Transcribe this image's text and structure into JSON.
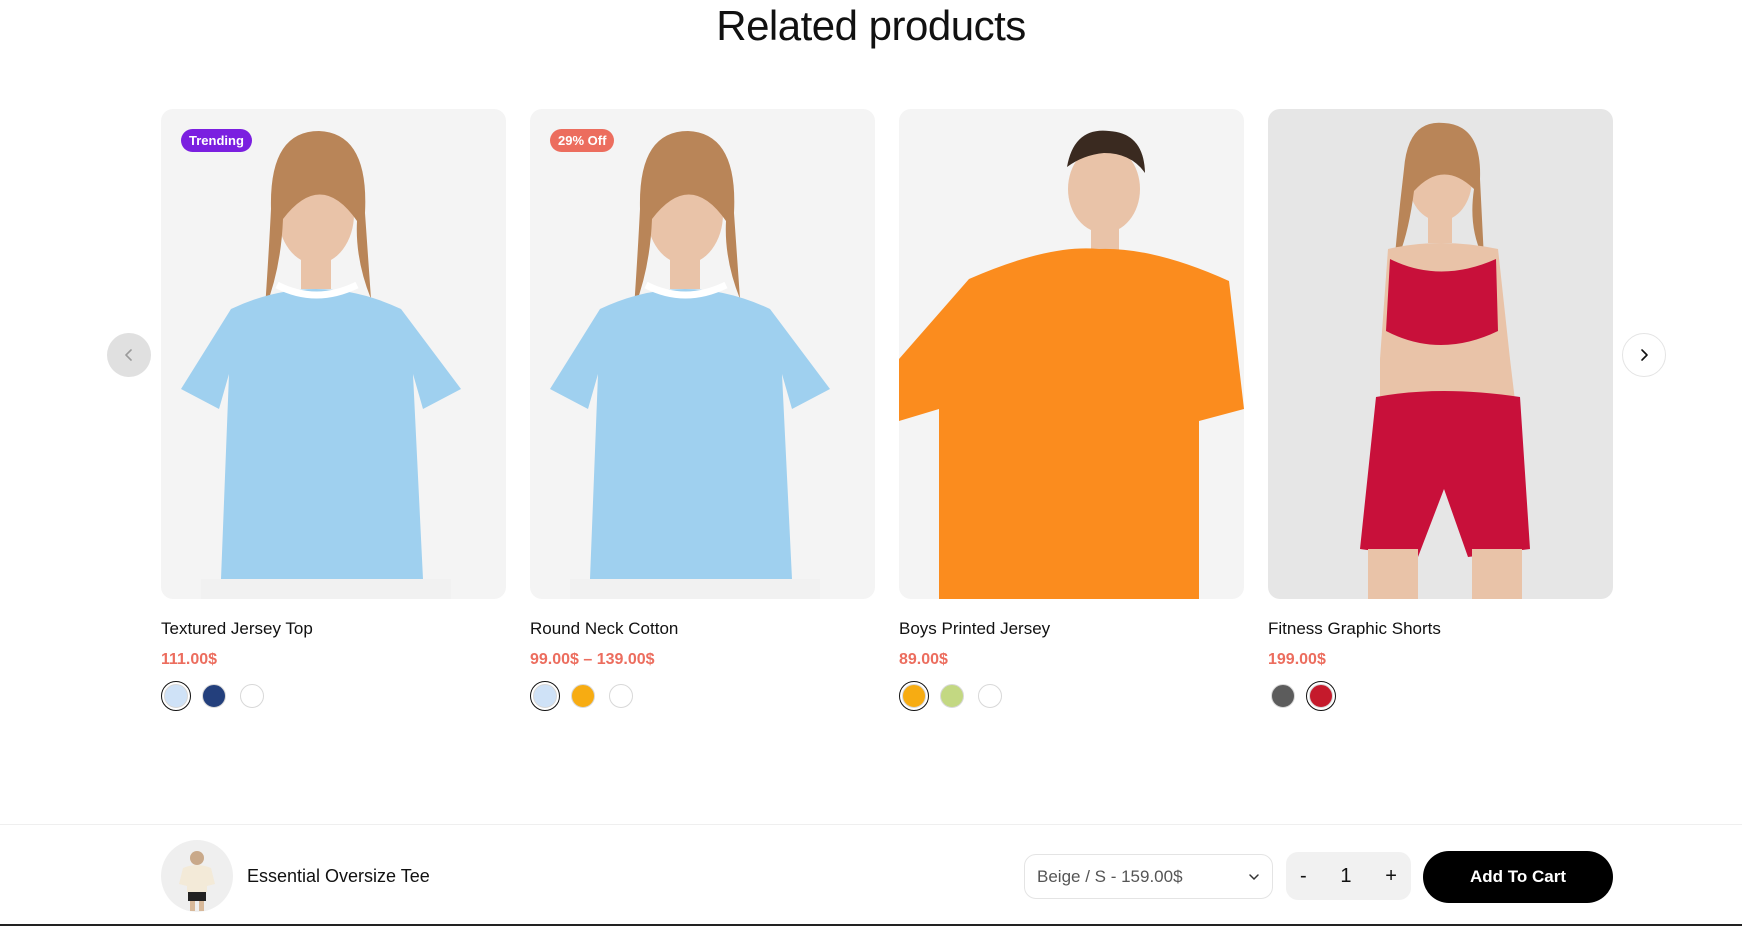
{
  "section": {
    "title": "Related products"
  },
  "products": [
    {
      "name": "Textured Jersey Top",
      "price": "111.00$",
      "badge": "Trending",
      "badge_color": "#7b1fe0",
      "bg": "#f4f4f4",
      "garment_color": "#9fd0ef",
      "swatches": [
        "#cfe2f7",
        "#233f7c",
        "#ffffff"
      ],
      "selected": 0
    },
    {
      "name": "Round Neck Cotton",
      "price": "99.00$ – 139.00$",
      "badge": "29% Off",
      "badge_color": "#ec6d5e",
      "bg": "#f4f4f4",
      "garment_color": "#9fd0ef",
      "swatches": [
        "#cfe2f7",
        "#f7ac12",
        "#ffffff"
      ],
      "selected": 0
    },
    {
      "name": "Boys Printed Jersey",
      "price": "89.00$",
      "badge": "",
      "badge_color": "",
      "bg": "#f4f4f4",
      "garment_color": "#fb8c1e",
      "swatches": [
        "#f7ac12",
        "#c3d882",
        "#ffffff"
      ],
      "selected": 0
    },
    {
      "name": "Fitness Graphic Shorts",
      "price": "199.00$",
      "badge": "",
      "badge_color": "",
      "bg": "#e6e6e6",
      "garment_color": "#c8103a",
      "swatches": [
        "#5c5c5c",
        "#c51a2c"
      ],
      "selected": 1
    }
  ],
  "sticky_bar": {
    "product_name": "Essential Oversize Tee",
    "variant": "Beige / S - 159.00$",
    "quantity": "1",
    "minus": "-",
    "plus": "+",
    "add_to_cart": "Add To Cart"
  },
  "colors": {
    "price": "#ec6d5e",
    "primary_button": "#000000"
  }
}
